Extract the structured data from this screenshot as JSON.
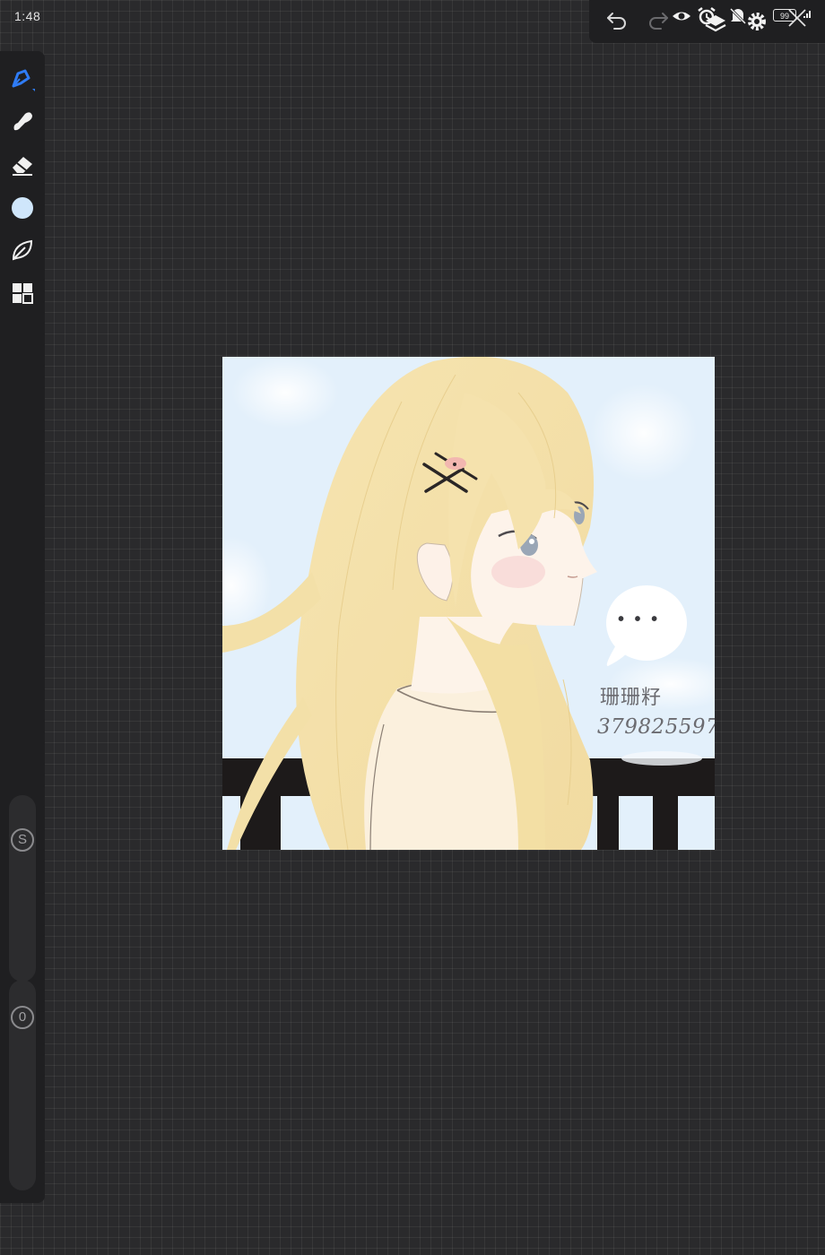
{
  "status_bar": {
    "time": "1:48",
    "battery": "99"
  },
  "top_toolbar": {
    "icons": [
      "undo-icon",
      "redo-icon",
      "eye-icon",
      "alarm-icon",
      "layers-icon",
      "mute-icon",
      "gear-icon",
      "battery-icon",
      "signal-icon",
      "close-icon"
    ]
  },
  "left_toolbar": {
    "tools": [
      "pen-icon",
      "smudge-icon",
      "eraser-icon",
      "color-swatch",
      "leaf-icon",
      "grid-icon"
    ],
    "active_tool": "pen-icon",
    "accent_color": "#2f7cf6",
    "current_color": "#cfe6fb"
  },
  "sliders": {
    "size_label": "S",
    "opacity_label": "0"
  },
  "artwork": {
    "watermark_name": "珊珊籽",
    "watermark_id": "379825597",
    "speech_bubble": "• • •"
  }
}
